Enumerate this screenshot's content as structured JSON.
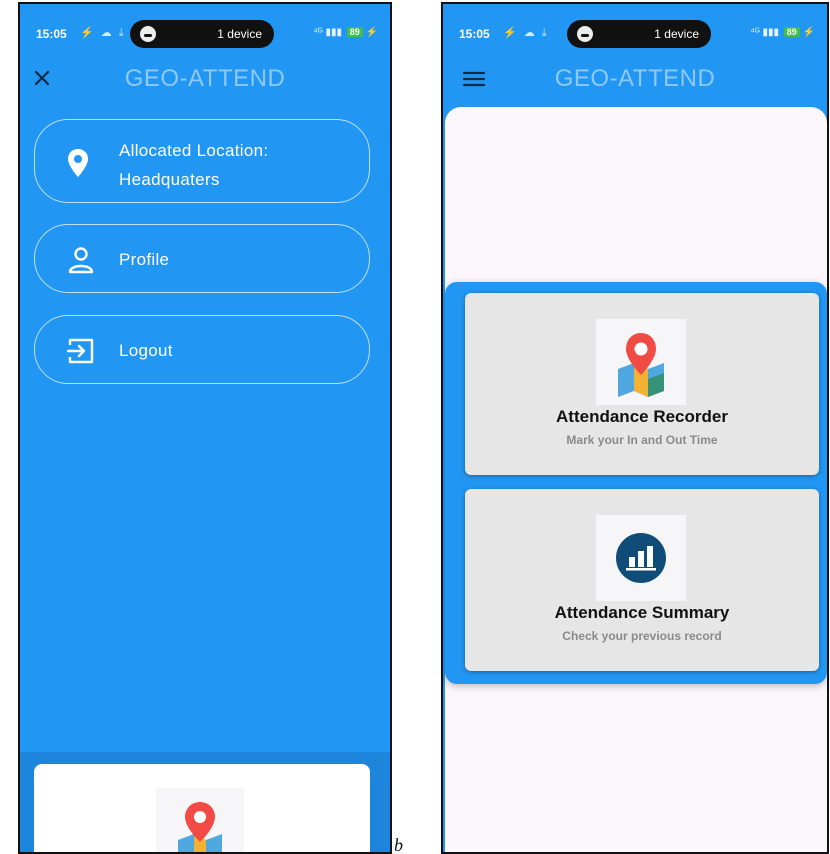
{
  "status_bar": {
    "time": "15:05",
    "left_icons": "⚡ ☁ ⤓",
    "pill_text": "1 device",
    "signal": "⁴ᴳ ▮▮▮",
    "battery": "89",
    "charging": "⚡"
  },
  "app": {
    "title": "GEO-ATTEND"
  },
  "drawer": {
    "close_icon": "close-icon",
    "items": [
      {
        "label_line1": "Allocated Location:",
        "label_line2": "Headquaters",
        "icon": "location-pin-icon"
      },
      {
        "label": "Profile",
        "icon": "person-icon"
      },
      {
        "label": "Logout",
        "icon": "logout-icon"
      }
    ]
  },
  "home": {
    "menu_icon": "hamburger-menu-icon",
    "cards": [
      {
        "title": "Attendance Recorder",
        "subtitle": "Mark your In and Out Time",
        "icon": "map-pin-icon"
      },
      {
        "title": "Attendance Summary",
        "subtitle": "Check your previous record",
        "icon": "bar-chart-icon"
      }
    ]
  },
  "figure_label": "b",
  "colors": {
    "primary": "#2196f3",
    "title_text": "#8fc9fb",
    "card_bg": "#e6e6e6",
    "content_bg": "#fbf7fd",
    "pin_red": "#f24b45",
    "chart_navy": "#0f4d78"
  }
}
